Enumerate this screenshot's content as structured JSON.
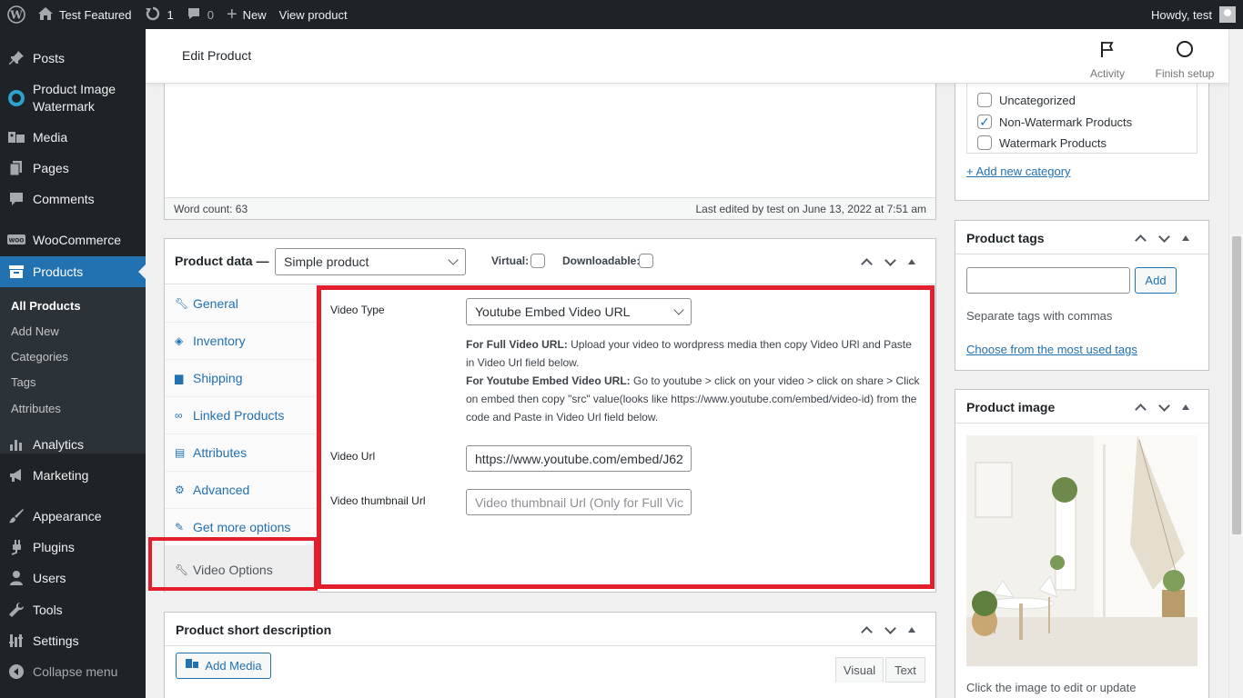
{
  "admin_bar": {
    "site_name": "Test Featured",
    "updates_count": "1",
    "comments_count": "0",
    "new_label": "New",
    "view_label": "View product",
    "howdy": "Howdy, test"
  },
  "menu": {
    "items": [
      {
        "label": "Posts",
        "icon": "pushpin-icon"
      },
      {
        "label": "Product Image Watermark",
        "icon": "circle-logo-icon"
      },
      {
        "label": "Media",
        "icon": "media-icon"
      },
      {
        "label": "Pages",
        "icon": "pages-icon"
      },
      {
        "label": "Comments",
        "icon": "comments-icon"
      },
      {
        "label": "WooCommerce",
        "icon": "woo-icon"
      },
      {
        "label": "Products",
        "icon": "archive-icon"
      },
      {
        "label": "Analytics",
        "icon": "bar-chart-icon"
      },
      {
        "label": "Marketing",
        "icon": "megaphone-icon"
      },
      {
        "label": "Appearance",
        "icon": "brush-icon"
      },
      {
        "label": "Plugins",
        "icon": "plugin-icon"
      },
      {
        "label": "Users",
        "icon": "user-icon"
      },
      {
        "label": "Tools",
        "icon": "wrench-icon"
      },
      {
        "label": "Settings",
        "icon": "settings-icon"
      },
      {
        "label": "Collapse menu",
        "icon": "collapse-icon"
      }
    ],
    "submenu": [
      "All Products",
      "Add New",
      "Categories",
      "Tags",
      "Attributes"
    ]
  },
  "header": {
    "title": "Edit Product",
    "activity": "Activity",
    "finish_setup": "Finish setup"
  },
  "editor": {
    "word_count": "Word count: 63",
    "last_edited": "Last edited by test on June 13, 2022 at 7:51 am"
  },
  "product_data": {
    "title": "Product data —",
    "type": "Simple product",
    "virtual": "Virtual:",
    "downloadable": "Downloadable:",
    "tabs": [
      "General",
      "Inventory",
      "Shipping",
      "Linked Products",
      "Attributes",
      "Advanced",
      "Get more options",
      "Video Options"
    ],
    "active_tab": "Video Options"
  },
  "video": {
    "type_label": "Video Type",
    "type_value": "Youtube Embed Video URL",
    "desc1_bold": "For Full Video URL:",
    "desc1": " Upload your video to wordpress media then copy Video URl and Paste in Video Url field below.",
    "desc2_bold": "For Youtube Embed Video URL:",
    "desc2": " Go to youtube > click on your video > click on share > Click on embed then copy \"src\" value(looks like https://www.youtube.com/embed/video-id) from the code and Paste in Video Url field below.",
    "url_label": "Video Url",
    "url_value": "https://www.youtube.com/embed/J62",
    "thumb_label": "Video thumbnail Url",
    "thumb_placeholder": "Video thumbnail Url (Only for Full Vic"
  },
  "short_description": {
    "title": "Product short description",
    "add_media": "Add Media",
    "visual": "Visual",
    "text": "Text"
  },
  "categories": {
    "items": [
      {
        "label": "Uncategorized",
        "checked": false
      },
      {
        "label": "Non-Watermark Products",
        "checked": true
      },
      {
        "label": "Watermark Products",
        "checked": false
      }
    ],
    "add_new": "+ Add new category"
  },
  "tags": {
    "title": "Product tags",
    "add": "Add",
    "hint": "Separate tags with commas",
    "choose": "Choose from the most used tags"
  },
  "image": {
    "title": "Product image",
    "hint": "Click the image to edit or update"
  },
  "colors": {
    "accent": "#2271b1",
    "highlight": "#e31e2d",
    "menu_bg": "#1d2327"
  }
}
